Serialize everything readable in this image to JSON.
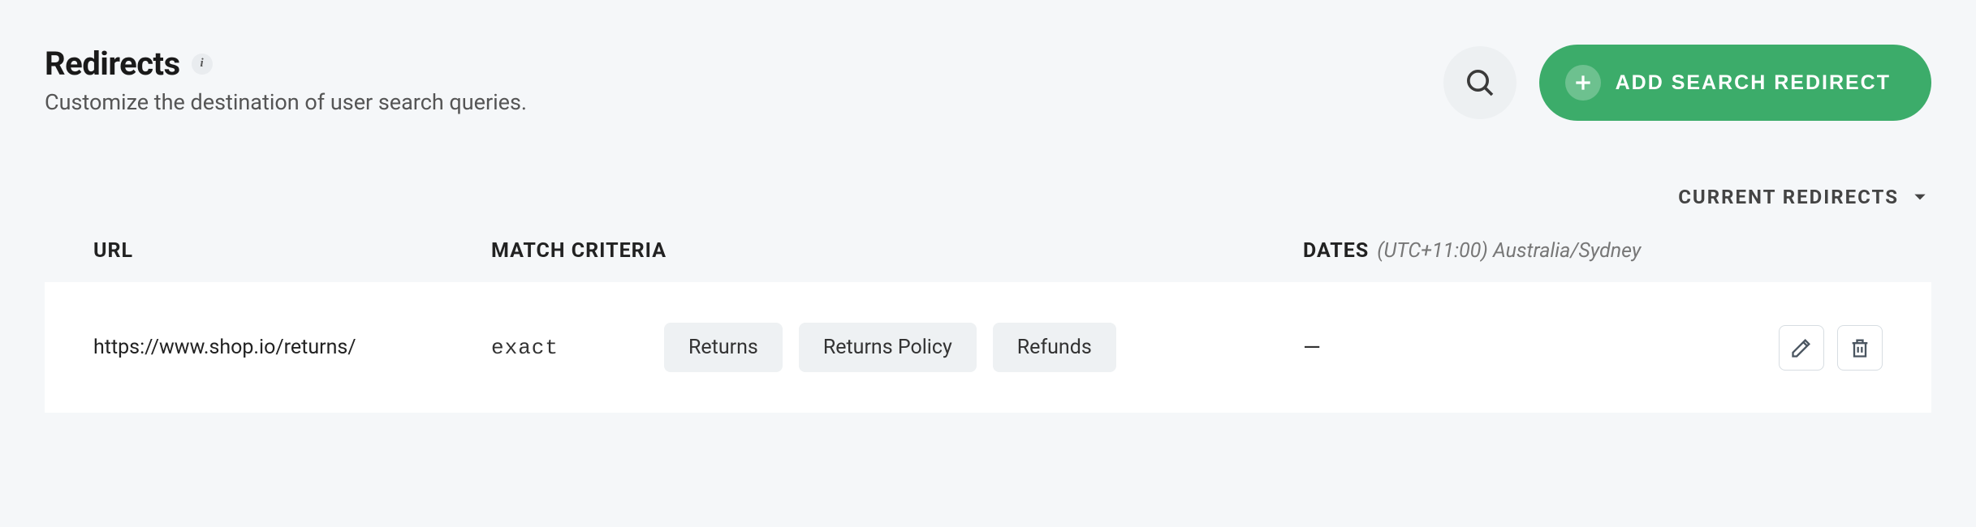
{
  "header": {
    "title": "Redirects",
    "subtitle": "Customize the destination of user search queries.",
    "add_button": "ADD SEARCH REDIRECT"
  },
  "filter": {
    "label": "CURRENT REDIRECTS"
  },
  "table": {
    "columns": {
      "url": "URL",
      "match": "MATCH CRITERIA",
      "dates": "DATES",
      "tz": "(UTC+11:00) Australia/Sydney"
    },
    "rows": [
      {
        "url": "https://www.shop.io/returns/",
        "match_type": "exact",
        "terms": [
          "Returns",
          "Returns Policy",
          "Refunds"
        ],
        "dates": "—"
      }
    ]
  }
}
